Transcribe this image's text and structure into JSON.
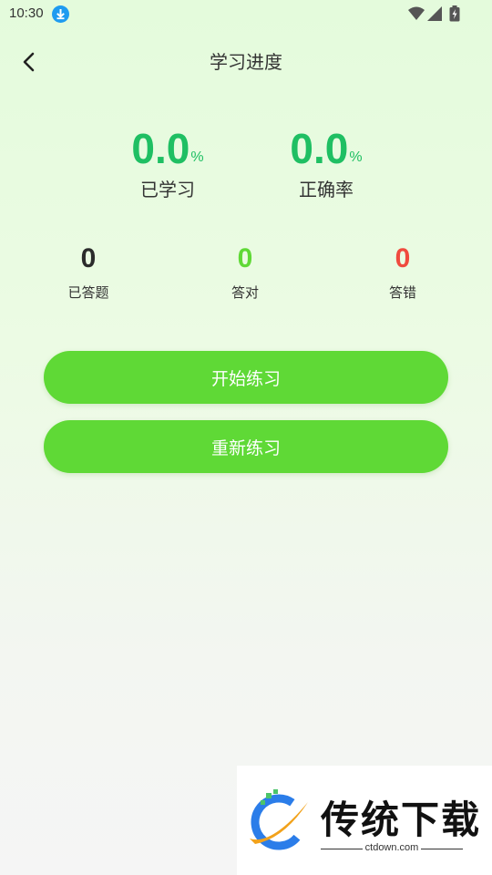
{
  "status_bar": {
    "time": "10:30"
  },
  "header": {
    "title": "学习进度"
  },
  "stats": {
    "learned": {
      "value": "0.0",
      "unit": "%",
      "label": "已学习"
    },
    "accuracy": {
      "value": "0.0",
      "unit": "%",
      "label": "正确率"
    }
  },
  "counts": {
    "answered": {
      "value": "0",
      "label": "已答题",
      "color": "#2b2b2b"
    },
    "correct": {
      "value": "0",
      "label": "答对",
      "color": "#5fd936"
    },
    "wrong": {
      "value": "0",
      "label": "答错",
      "color": "#f04a3e"
    }
  },
  "buttons": {
    "start": "开始练习",
    "restart": "重新练习"
  },
  "colors": {
    "accent": "#5fd936",
    "stat_green": "#1fbf63"
  },
  "watermark": {
    "name": "传统下载",
    "site": "ctdown.com"
  }
}
